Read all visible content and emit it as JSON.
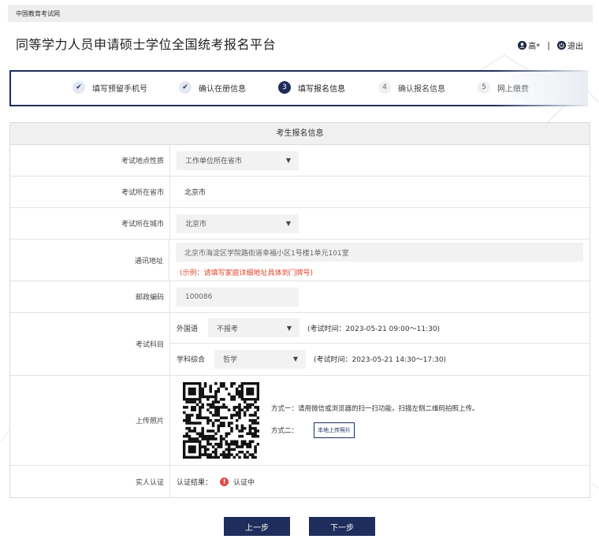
{
  "topbar": {
    "site_name": "中国教育考试网"
  },
  "header": {
    "title": "同等学力人员申请硕士学位全国统考报名平台",
    "user_name": "高*",
    "separator": "|",
    "logout_label": "退出"
  },
  "steps": [
    {
      "num": "✔",
      "label": "填写预留手机号",
      "state": "done"
    },
    {
      "num": "✔",
      "label": "确认在册信息",
      "state": "done"
    },
    {
      "num": "3",
      "label": "填写报名信息",
      "state": "active"
    },
    {
      "num": "4",
      "label": "确认报名信息",
      "state": "todo"
    },
    {
      "num": "5",
      "label": "网上缴费",
      "state": "todo"
    }
  ],
  "form": {
    "title": "考生报名信息",
    "exam_site_type": {
      "label": "考试地点性质",
      "value": "工作单位所在省市"
    },
    "exam_province": {
      "label": "考试所在省市",
      "value": "北京市"
    },
    "exam_city": {
      "label": "考试所在城市",
      "value": "北京市"
    },
    "address": {
      "label": "通讯地址",
      "value": "北京市海淀区学院路街道幸福小区1号楼1单元101室",
      "hint": "(示例：请填写家庭详细地址具体到门牌号)"
    },
    "postcode": {
      "label": "邮政编码",
      "value": "100086"
    },
    "subjects": {
      "label": "考试科目",
      "foreign": {
        "name": "外国语",
        "value": "不报考",
        "time": "(考试时间：2023-05-21 09:00～11:30)"
      },
      "comprehensive": {
        "name": "学科综合",
        "value": "哲学",
        "time": "(考试时间：2023-05-21 14:30～17:30)"
      }
    },
    "photo": {
      "label": "上传照片",
      "method1": "方式一：请用微信或浏览器的扫一扫功能，扫描左侧二维码拍照上传。",
      "method2": "方式二：",
      "upload_button": "本地上传照片"
    },
    "realname": {
      "label": "实人认证",
      "result_label": "认证结果：",
      "status": "认证中"
    }
  },
  "buttons": {
    "prev": "上一步",
    "next": "下一步"
  },
  "colors": {
    "primary": "#1f2d5c",
    "warning": "#e14b4b",
    "hint": "#e0472f"
  },
  "icons": {
    "user": "user-icon",
    "logout": "power-icon",
    "check": "check-icon",
    "caret": "caret-down-icon",
    "warning": "exclamation-icon"
  }
}
